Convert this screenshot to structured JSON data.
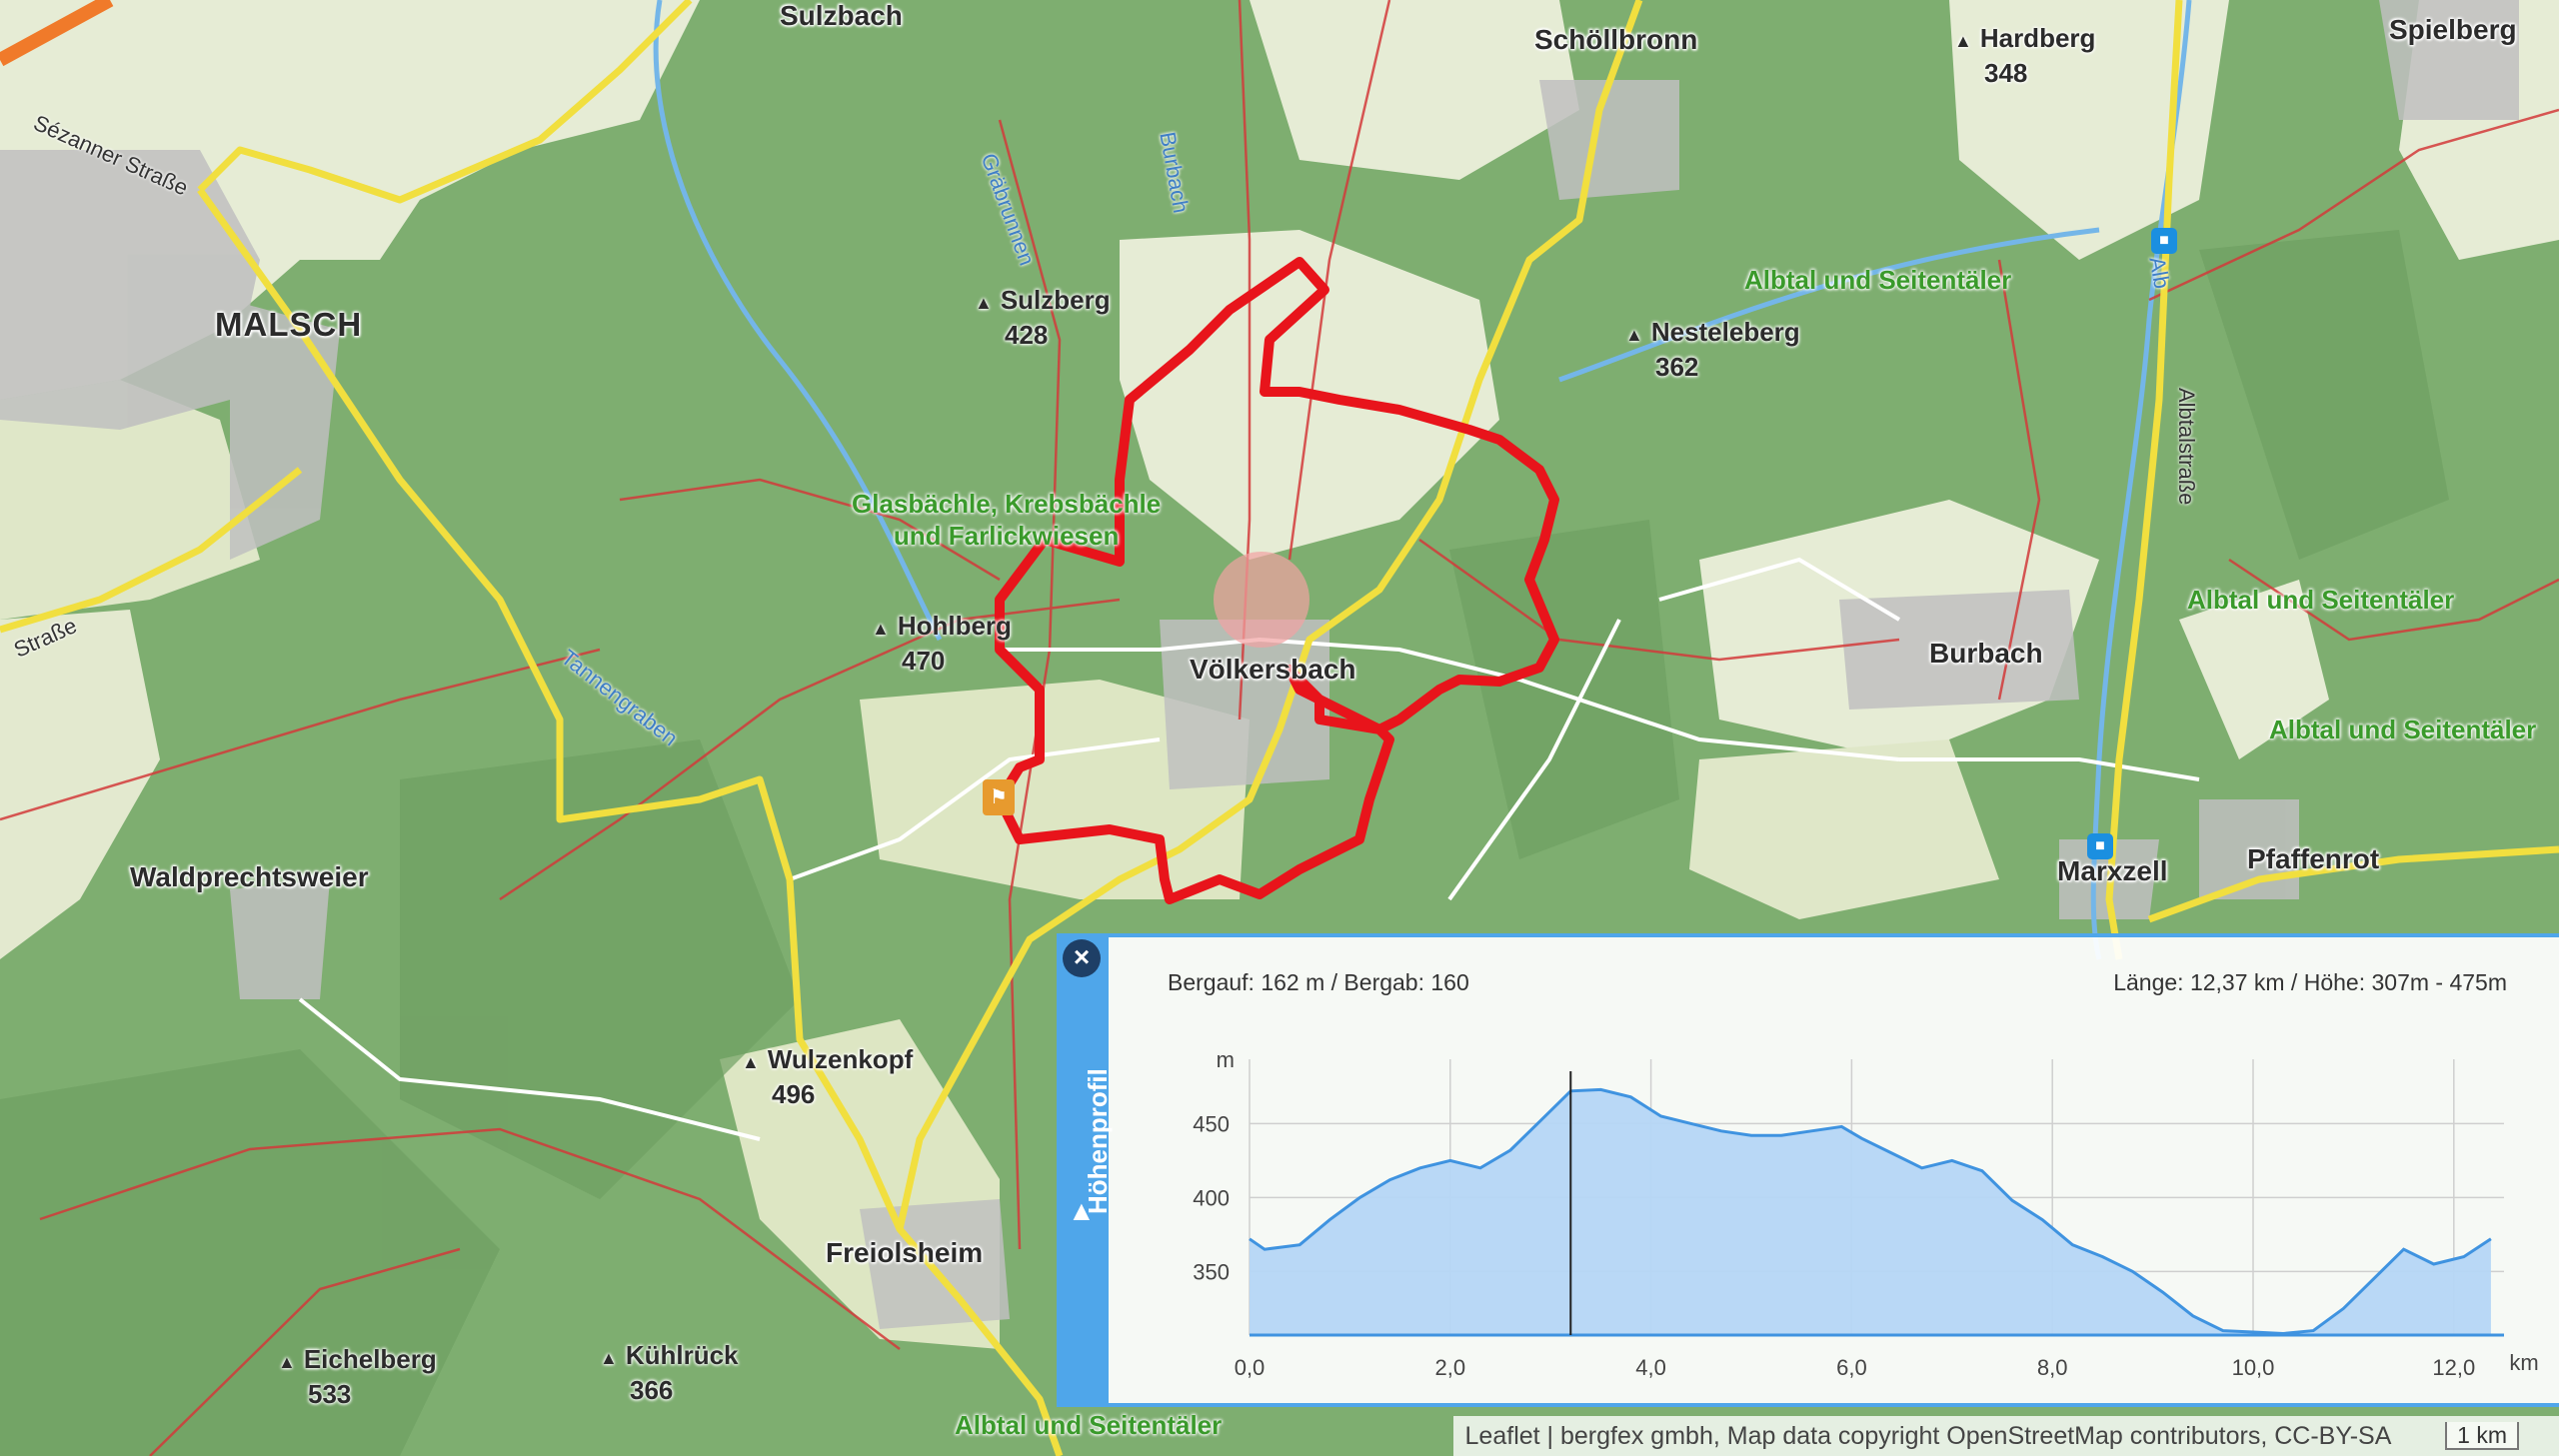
{
  "map": {
    "places": [
      {
        "id": "malsch",
        "label": "MALSCH",
        "type": "city"
      },
      {
        "id": "sulzbach",
        "label": "Sulzbach",
        "type": "village"
      },
      {
        "id": "schoellbronn",
        "label": "Schöllbronn",
        "type": "village"
      },
      {
        "id": "spielberg",
        "label": "Spielberg",
        "type": "village"
      },
      {
        "id": "voelkersbach",
        "label": "Völkersbach",
        "type": "village"
      },
      {
        "id": "burbach",
        "label": "Burbach",
        "type": "village"
      },
      {
        "id": "waldprechtsweier",
        "label": "Waldprechtsweier",
        "type": "village"
      },
      {
        "id": "marxzell",
        "label": "Marxzell",
        "type": "village"
      },
      {
        "id": "pfaffenrot",
        "label": "Pfaffenrot",
        "type": "village"
      },
      {
        "id": "freiolsheim",
        "label": "Freiolsheim",
        "type": "village"
      }
    ],
    "peaks": [
      {
        "id": "hardberg",
        "name": "Hardberg",
        "elevation": "348"
      },
      {
        "id": "sulzberg",
        "name": "Sulzberg",
        "elevation": "428"
      },
      {
        "id": "nesteleberg",
        "name": "Nesteleberg",
        "elevation": "362"
      },
      {
        "id": "hohlberg",
        "name": "Hohlberg",
        "elevation": "470"
      },
      {
        "id": "wulzenkopf",
        "name": "Wulzenkopf",
        "elevation": "496"
      },
      {
        "id": "eichelberg",
        "name": "Eichelberg",
        "elevation": "533"
      },
      {
        "id": "kuehlrueck",
        "name": "Kühlrück",
        "elevation": "366"
      }
    ],
    "nature_areas": [
      {
        "id": "albtal-1",
        "label": "Albtal und Seitentäler"
      },
      {
        "id": "albtal-2",
        "label": "Albtal und Seitentäler"
      },
      {
        "id": "albtal-3",
        "label": "Albtal und Seitentäler"
      },
      {
        "id": "albtal-4",
        "label": "Albtal und Seitentäler"
      },
      {
        "id": "glasbaechle",
        "label": "Glasbächle, Krebsbächle\nund Farlickwiesen"
      }
    ],
    "waterways": [
      {
        "id": "burbach-creek",
        "label": "Burbach"
      },
      {
        "id": "graebrunnen",
        "label": "Gräbrunnen"
      },
      {
        "id": "tannengraben",
        "label": "Tannengraben"
      },
      {
        "id": "alb",
        "label": "Alb"
      }
    ],
    "streets": [
      {
        "id": "sezanner",
        "label": "Sézanner Straße"
      },
      {
        "id": "strasse-west",
        "label": "Straße"
      },
      {
        "id": "albtalstrasse",
        "label": "Albtalstraße"
      }
    ],
    "route_color": "#e8141b",
    "colors": {
      "forest": "#7fb174",
      "meadow": "#e6ecd5",
      "road_major": "#f1df3f",
      "path": "#d23a3a",
      "water": "#74b6e8"
    }
  },
  "profile": {
    "title": "Höhenprofil",
    "close_label": "×",
    "ascent_descent": "Bergauf: 162 m / Bergab: 160",
    "length_height": "Länge: 12,37 km / Höhe: 307m - 475m",
    "y_unit": "m",
    "x_unit": "km",
    "cursor_km": 3.2
  },
  "chart_data": {
    "type": "area",
    "title": "",
    "xlabel": "km",
    "ylabel": "m",
    "xlim": [
      0,
      12.5
    ],
    "ylim": [
      307,
      480
    ],
    "x_ticks": [
      "0,0",
      "2,0",
      "4,0",
      "6,0",
      "8,0",
      "10,0",
      "12,0"
    ],
    "x_tick_values": [
      0,
      2,
      4,
      6,
      8,
      10,
      12
    ],
    "y_ticks": [
      "350",
      "400",
      "450"
    ],
    "y_tick_values": [
      350,
      400,
      450
    ],
    "series": [
      {
        "x": [
          0,
          0.15,
          0.5,
          0.8,
          1.1,
          1.4,
          1.7,
          2.0,
          2.3,
          2.6,
          2.9,
          3.2,
          3.5,
          3.8,
          4.1,
          4.4,
          4.7,
          5.0,
          5.3,
          5.6,
          5.9,
          6.1,
          6.4,
          6.7,
          7.0,
          7.3,
          7.6,
          7.9,
          8.2,
          8.5,
          8.8,
          9.1,
          9.4,
          9.7,
          10.0,
          10.3,
          10.6,
          10.9,
          11.2,
          11.5,
          11.8,
          12.1,
          12.37
        ],
        "y": [
          372,
          365,
          368,
          385,
          400,
          412,
          420,
          425,
          420,
          432,
          452,
          472,
          473,
          468,
          455,
          450,
          445,
          442,
          442,
          445,
          448,
          440,
          430,
          420,
          425,
          418,
          398,
          385,
          368,
          360,
          350,
          336,
          320,
          310,
          309,
          308,
          310,
          325,
          345,
          365,
          355,
          360,
          372
        ]
      }
    ]
  },
  "attribution": {
    "text": "Leaflet | bergfex gmbh, Map data copyright OpenStreetMap contributors, CC-BY-SA",
    "scale": "1 km"
  }
}
